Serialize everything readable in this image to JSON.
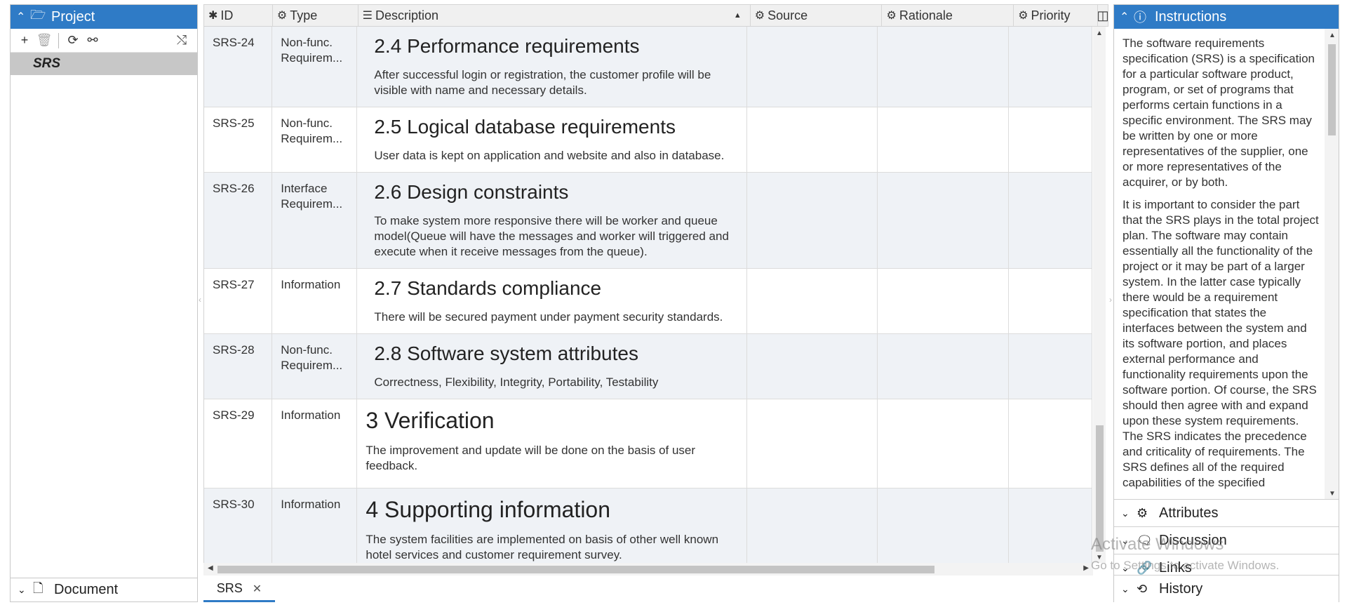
{
  "project_panel": {
    "title": "Project",
    "tree_item": "SRS",
    "footer": "Document"
  },
  "table": {
    "columns": {
      "id": "ID",
      "type": "Type",
      "description": "Description",
      "source": "Source",
      "rationale": "Rationale",
      "priority": "Priority"
    },
    "rows": [
      {
        "id": "SRS-24",
        "type": "Non-func. Requirem...",
        "heading": "2.4 Performance requirements",
        "text": "After successful login or registration, the customer profile will be visible with name and necessary details."
      },
      {
        "id": "SRS-25",
        "type": "Non-func. Requirem...",
        "heading": "2.5 Logical database requirements",
        "text": "User data is kept on application and website and also in database."
      },
      {
        "id": "SRS-26",
        "type": "Interface Requirem...",
        "heading": "2.6 Design constraints",
        "text": "To make system more responsive there will be worker and queue model(Queue will have the messages and worker will triggered and execute when it receive messages from the queue)."
      },
      {
        "id": "SRS-27",
        "type": "Information",
        "heading": "2.7 Standards compliance",
        "text": "There will be secured payment under payment security standards."
      },
      {
        "id": "SRS-28",
        "type": "Non-func. Requirem...",
        "heading": "2.8 Software system attributes",
        "text": "Correctness, Flexibility, Integrity, Portability, Testability"
      },
      {
        "id": "SRS-29",
        "type": "Information",
        "heading": "3 Verification",
        "text": "The improvement and update will be done on the basis of user feedback."
      },
      {
        "id": "SRS-30",
        "type": "Information",
        "heading": "4 Supporting information",
        "text": "The system facilities are implemented on basis of other well known hotel services and customer requirement survey."
      }
    ]
  },
  "tabs": [
    {
      "label": "SRS"
    }
  ],
  "instructions_panel": {
    "title": "Instructions",
    "paragraphs": [
      "The software requirements specification (SRS) is a specification for a particular software product, program, or set of programs that performs certain functions in a specific environment. The SRS may be written by one or more representatives of the supplier, one or more representatives of the acquirer, or by both.",
      "It is important to consider the part that the SRS plays in the total project plan. The software may contain essentially all the functionality of the project or it may be part of a larger system. In the latter case typically there would be a requirement specification that states the interfaces between the system and its software portion, and places external performance and functionality requirements upon the software portion. Of course, the SRS should then agree with and expand upon these system requirements. The SRS indicates the precedence and criticality of requirements. The SRS defines all of the required capabilities of the specified"
    ],
    "sections": [
      "Attributes",
      "Discussion",
      "Links",
      "History"
    ]
  },
  "watermark": {
    "title": "Activate Windows",
    "subtitle": "Go to Settings to activate Windows."
  }
}
